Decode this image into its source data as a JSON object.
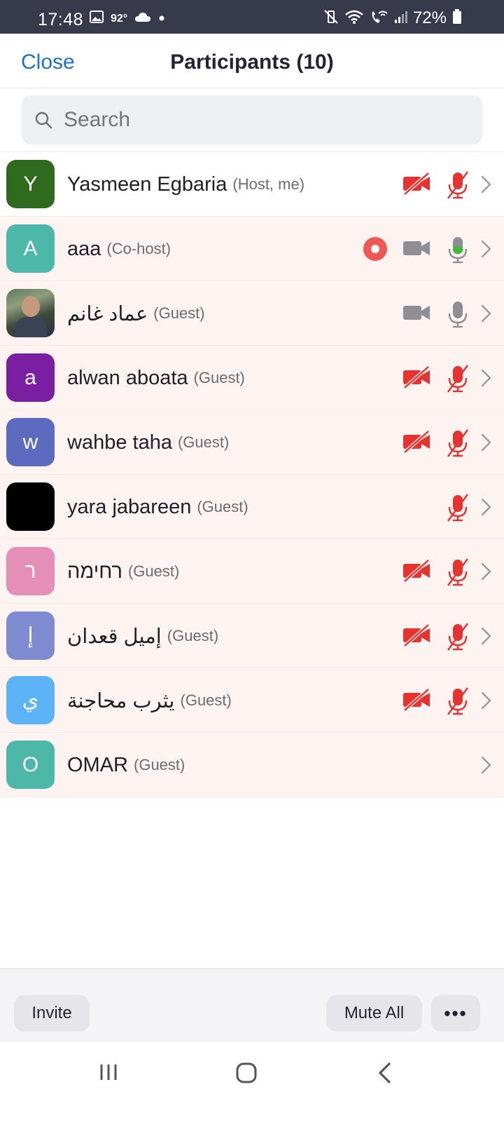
{
  "status_bar": {
    "time": "17:48",
    "temperature": "92°",
    "battery": "72%"
  },
  "header": {
    "close_label": "Close",
    "title": "Participants (10)"
  },
  "search": {
    "placeholder": "Search"
  },
  "participants": [
    {
      "avatar_letter": "Y",
      "avatar_color": "#2e6b1f",
      "name": "Yasmeen Egbaria",
      "role": "(Host, me)",
      "video": "off",
      "mic": "muted",
      "recording": false
    },
    {
      "avatar_letter": "A",
      "avatar_color": "#4db8a9",
      "name": "aaa",
      "role": "(Co-host)",
      "video": "on",
      "mic": "active",
      "recording": true
    },
    {
      "avatar_letter": "",
      "avatar_color": "#6b7f62",
      "name": "عماد غانم",
      "role": "(Guest)",
      "video": "on",
      "mic": "on",
      "recording": false
    },
    {
      "avatar_letter": "a",
      "avatar_color": "#7b1fa2",
      "name": "alwan aboata",
      "role": "(Guest)",
      "video": "off",
      "mic": "muted",
      "recording": false
    },
    {
      "avatar_letter": "w",
      "avatar_color": "#5c6bc0",
      "name": "wahbe taha",
      "role": "(Guest)",
      "video": "off",
      "mic": "muted",
      "recording": false
    },
    {
      "avatar_letter": "",
      "avatar_color": "#000000",
      "name": "yara jabareen",
      "role": "(Guest)",
      "video": "none",
      "mic": "muted",
      "recording": false
    },
    {
      "avatar_letter": "ר",
      "avatar_color": "#e58fb8",
      "name": "רחימה",
      "role": "(Guest)",
      "video": "off",
      "mic": "muted",
      "recording": false
    },
    {
      "avatar_letter": "إ",
      "avatar_color": "#7e8bd0",
      "name": "إميل قعدان",
      "role": "(Guest)",
      "video": "off",
      "mic": "muted",
      "recording": false
    },
    {
      "avatar_letter": "ي",
      "avatar_color": "#5cb3f5",
      "name": "يثرب محاجنة",
      "role": "(Guest)",
      "video": "off",
      "mic": "muted",
      "recording": false
    },
    {
      "avatar_letter": "O",
      "avatar_color": "#4db8a9",
      "name": "OMAR",
      "role": "(Guest)",
      "video": "none",
      "mic": "none",
      "recording": false
    }
  ],
  "footer": {
    "invite_label": "Invite",
    "mute_all_label": "Mute All",
    "more_label": "•••"
  },
  "colors": {
    "accent": "#1b6fd0",
    "muted_red": "#e8322f",
    "mic_active_green": "#3dbb3a",
    "icon_gray": "#8e8e94",
    "record_red": "#f05654"
  }
}
